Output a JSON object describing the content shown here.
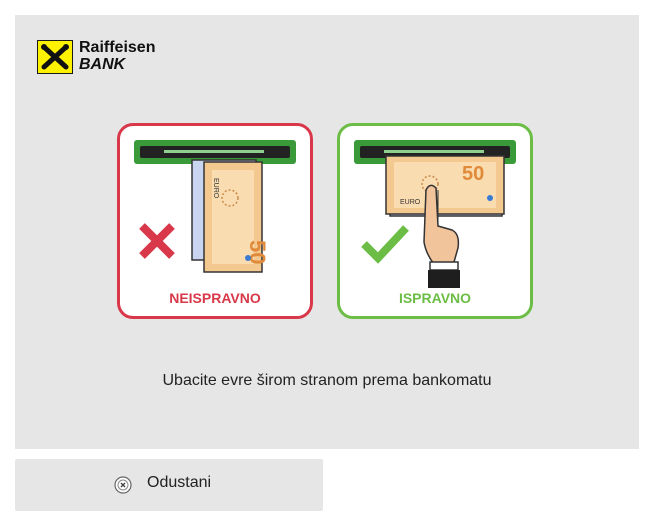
{
  "brand": {
    "name_line1": "Raiffeisen",
    "name_line2": "BANK",
    "logo_icon": "raiffeisen-crossed-gables-icon",
    "logo_color": "#fff200"
  },
  "cards": [
    {
      "label": "NEISPRAVNO",
      "mark_icon": "red-x-icon",
      "status_color": "#d8384a",
      "banknote_value": "50"
    },
    {
      "label": "ISPRAVNO",
      "mark_icon": "green-check-icon",
      "status_color": "#6cbd45",
      "banknote_value": "50"
    }
  ],
  "banknote_text": "EURO",
  "instruction": "Ubacite evre širom stranom prema bankomatu",
  "cancel": {
    "label": "Odustani",
    "icon": "close-circle-icon"
  },
  "colors": {
    "panel_bg": "#e6e6e6",
    "slot_green": "#3a9a3a"
  }
}
